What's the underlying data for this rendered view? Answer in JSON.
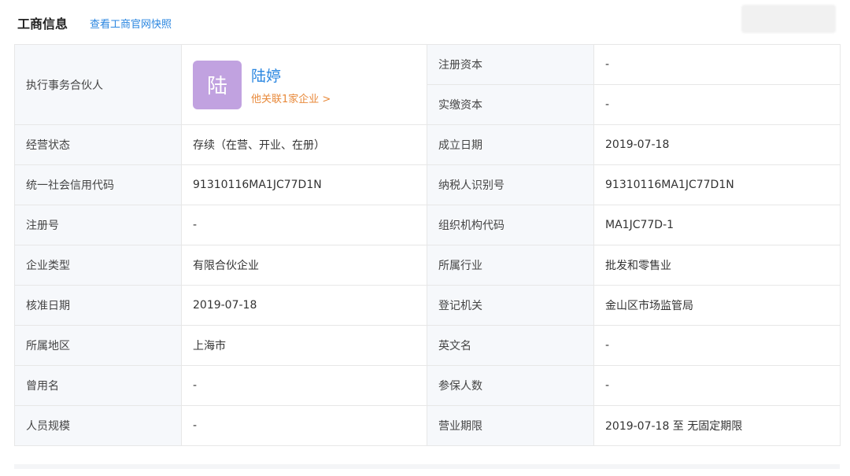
{
  "header": {
    "title": "工商信息",
    "link": "查看工商官网快照"
  },
  "partner": {
    "label": "执行事务合伙人",
    "avatar_char": "陆",
    "avatar_color": "#c1a2e0",
    "name": "陆婷",
    "related": "他关联1家企业 >"
  },
  "capital": {
    "registered_label": "注册资本",
    "registered_value": "-",
    "paid_label": "实缴资本",
    "paid_value": "-"
  },
  "rows": [
    {
      "l1": "经营状态",
      "v1": "存续（在营、开业、在册）",
      "l2": "成立日期",
      "v2": "2019-07-18"
    },
    {
      "l1": "统一社会信用代码",
      "v1": "91310116MA1JC77D1N",
      "l2": "纳税人识别号",
      "v2": "91310116MA1JC77D1N"
    },
    {
      "l1": "注册号",
      "v1": "-",
      "l2": "组织机构代码",
      "v2": "MA1JC77D-1"
    },
    {
      "l1": "企业类型",
      "v1": "有限合伙企业",
      "l2": "所属行业",
      "v2": "批发和零售业"
    },
    {
      "l1": "核准日期",
      "v1": "2019-07-18",
      "l2": "登记机关",
      "v2": "金山区市场监管局"
    },
    {
      "l1": "所属地区",
      "v1": "上海市",
      "l2": "英文名",
      "v2": "-"
    },
    {
      "l1": "曾用名",
      "v1": "-",
      "l2": "参保人数",
      "v2": "-"
    },
    {
      "l1": "人员规模",
      "v1": "-",
      "l2": "营业期限",
      "v2": "2019-07-18 至 无固定期限"
    }
  ],
  "colors": {
    "accent": "#2a86e0",
    "relation": "#e8893a",
    "label_bg": "#f6f8fb"
  }
}
